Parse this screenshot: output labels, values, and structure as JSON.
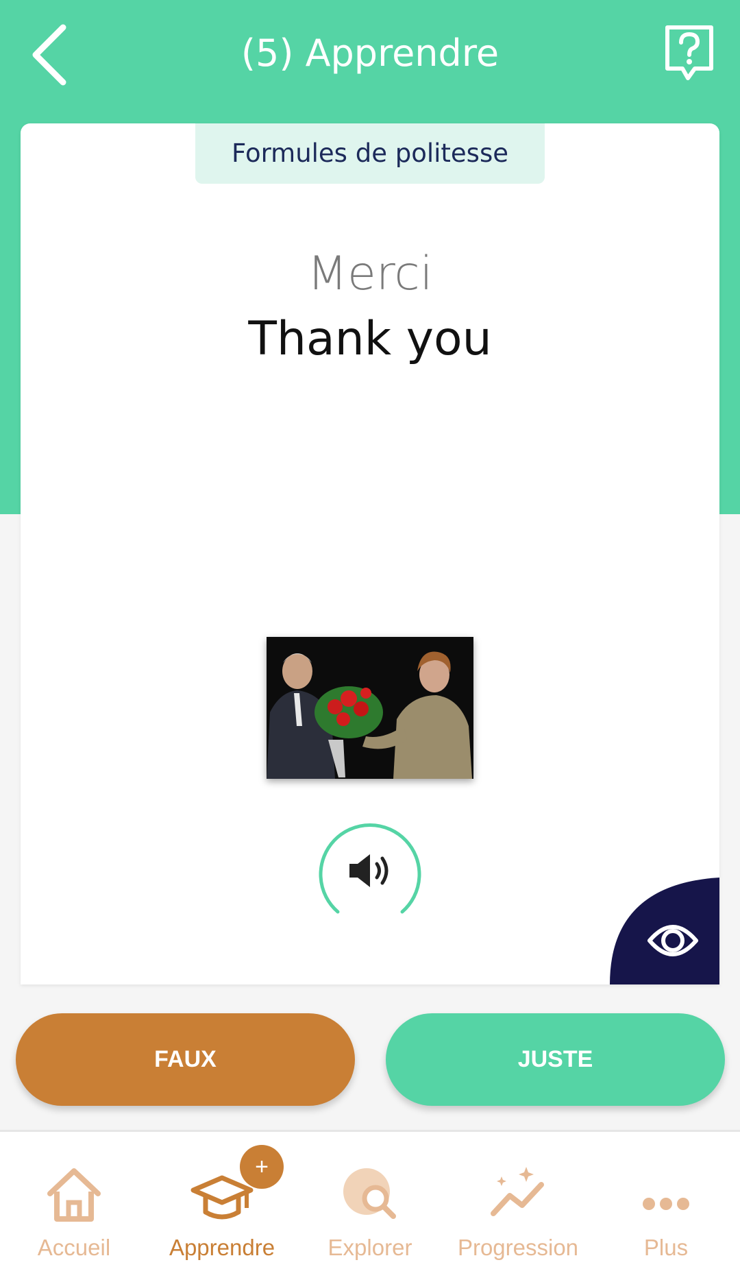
{
  "header": {
    "title": "(5) Apprendre",
    "background_color": "#55d4a5"
  },
  "card": {
    "category": "Formules de politesse",
    "word_native": "Merci",
    "word_target": "Thank you"
  },
  "actions": {
    "false_label": "FAUX",
    "true_label": "JUSTE",
    "false_color": "#c97f35",
    "true_color": "#55d4a5"
  },
  "nav": {
    "items": [
      {
        "label": "Accueil",
        "icon": "home-icon"
      },
      {
        "label": "Apprendre",
        "icon": "graduation-cap-icon",
        "active": true
      },
      {
        "label": "Explorer",
        "icon": "globe-search-icon"
      },
      {
        "label": "Progression",
        "icon": "progress-chart-icon"
      },
      {
        "label": "Plus",
        "icon": "more-dots-icon"
      }
    ],
    "badge": "+"
  }
}
